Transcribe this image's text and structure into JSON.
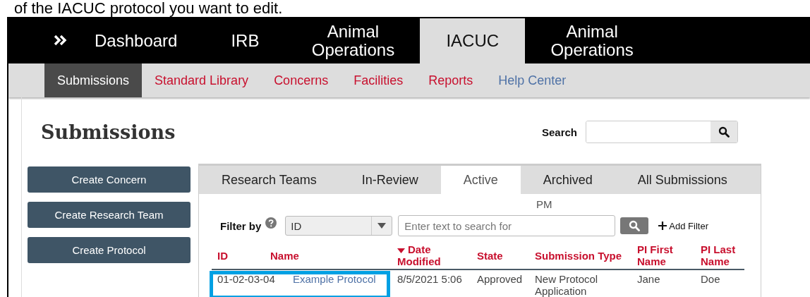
{
  "instruction_text": "of the IACUC protocol you want to edit.",
  "top_nav": {
    "items": [
      {
        "label": "Dashboard",
        "selected": false
      },
      {
        "label": "IRB",
        "selected": false
      },
      {
        "label": "Animal Operations",
        "selected": false
      },
      {
        "label": "IACUC",
        "selected": true
      },
      {
        "label": "Animal Operations",
        "selected": false
      }
    ]
  },
  "sub_nav": {
    "items": [
      {
        "label": "Submissions",
        "selected": true,
        "kind": "module"
      },
      {
        "label": "Standard Library",
        "selected": false,
        "kind": "module"
      },
      {
        "label": "Concerns",
        "selected": false,
        "kind": "module"
      },
      {
        "label": "Facilities",
        "selected": false,
        "kind": "module"
      },
      {
        "label": "Reports",
        "selected": false,
        "kind": "module"
      },
      {
        "label": "Help Center",
        "selected": false,
        "kind": "help"
      }
    ]
  },
  "page_title": "Submissions",
  "search": {
    "label": "Search"
  },
  "actions": [
    "Create Concern",
    "Create Research Team",
    "Create Protocol"
  ],
  "tabs": [
    {
      "label": "Research Teams",
      "selected": false
    },
    {
      "label": "In-Review",
      "selected": false
    },
    {
      "label": "Active",
      "selected": true
    },
    {
      "label": "Archived",
      "selected": false
    },
    {
      "label": "All Submissions",
      "selected": false
    }
  ],
  "stray_text": "PM",
  "filter": {
    "label": "Filter by",
    "field": "ID",
    "placeholder": "Enter text to search for",
    "add_filter": "Add Filter"
  },
  "table": {
    "columns": [
      {
        "label": "ID",
        "sorted": false
      },
      {
        "label": "Name",
        "sorted": false
      },
      {
        "label": "Date Modified",
        "sorted": true
      },
      {
        "label": "State",
        "sorted": false
      },
      {
        "label": "Submission Type",
        "sorted": false
      },
      {
        "label": "PI First Name",
        "sorted": false
      },
      {
        "label": "PI Last Name",
        "sorted": false
      }
    ],
    "rows": [
      {
        "highlighted": true,
        "cells": [
          "01-02-03-04",
          "Example Protocol",
          "8/5/2021 5:06",
          "Approved",
          "New Protocol Application",
          "Jane",
          "Doe"
        ]
      }
    ]
  }
}
